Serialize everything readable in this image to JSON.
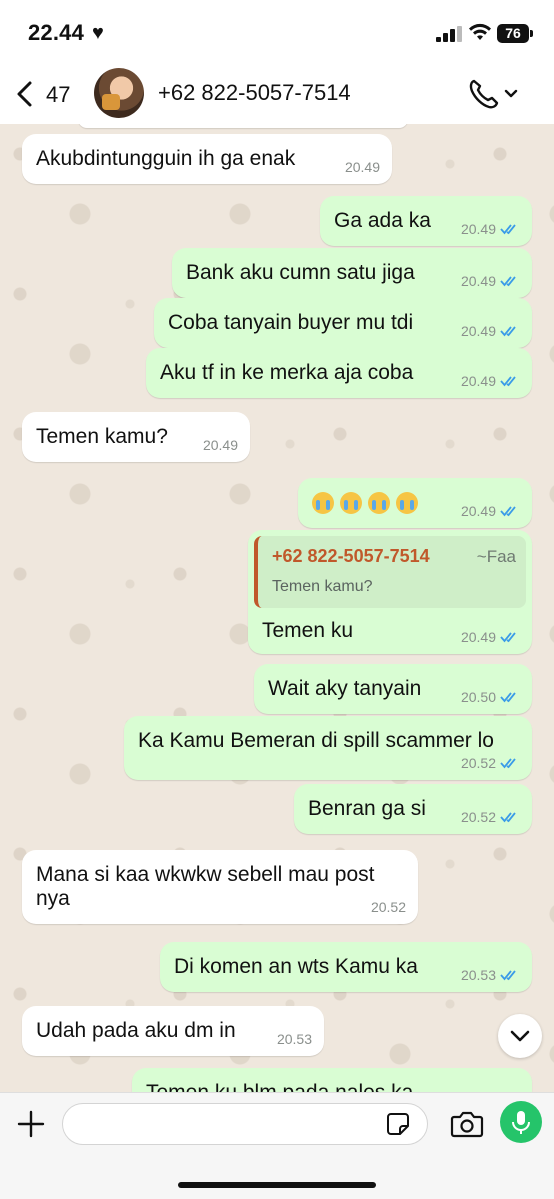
{
  "status_bar": {
    "time": "22.44",
    "battery": "76"
  },
  "header": {
    "back_count": "47",
    "contact_name": "+62 822-5057-7514"
  },
  "messages": [
    {
      "dir": "in",
      "text": "Akubdintungguin ih ga enak",
      "time": "20.49"
    },
    {
      "dir": "out",
      "text": "Ga ada ka",
      "time": "20.49"
    },
    {
      "dir": "out",
      "text": "Bank aku cumn satu jiga",
      "time": "20.49"
    },
    {
      "dir": "out",
      "text": "Coba tanyain buyer mu tdi",
      "time": "20.49"
    },
    {
      "dir": "out",
      "text": "Aku tf in ke merka aja coba",
      "time": "20.49"
    },
    {
      "dir": "in",
      "text": "Temen kamu?",
      "time": "20.49"
    },
    {
      "dir": "out",
      "emoji": "loudly-crying-face",
      "emoji_count": 4,
      "time": "20.49"
    },
    {
      "dir": "out",
      "quote": {
        "author": "+62 822-5057-7514",
        "alias": "~Faa",
        "text": "Temen kamu?"
      },
      "text": "Temen ku",
      "time": "20.49"
    },
    {
      "dir": "out",
      "text": "Wait aky tanyain",
      "time": "20.50"
    },
    {
      "dir": "out",
      "text": "Ka Kamu Bemeran di spill scammer lo",
      "time": "20.52"
    },
    {
      "dir": "out",
      "text": "Benran ga si",
      "time": "20.52"
    },
    {
      "dir": "in",
      "text_line1": "Mana si kaa wkwkw sebell mau post",
      "text_line2": "nya",
      "time": "20.52"
    },
    {
      "dir": "out",
      "text": "Di komen an wts Kamu ka",
      "time": "20.53"
    },
    {
      "dir": "in",
      "text": "Udah pada aku dm in",
      "time": "20.53"
    },
    {
      "dir": "out",
      "text": "Temen ku blm pada nales ka",
      "time": ""
    }
  ],
  "input": {
    "placeholder": ""
  },
  "colors": {
    "outgoing_bubble": "#d9fdd3",
    "incoming_bubble": "#ffffff",
    "read_ticks": "#3a9be8",
    "quote_accent": "#c0582b",
    "mic_button": "#25c46a"
  }
}
